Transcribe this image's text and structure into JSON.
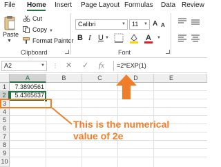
{
  "menu": {
    "tabs": [
      {
        "label": "File"
      },
      {
        "label": "Home"
      },
      {
        "label": "Insert"
      },
      {
        "label": "Page Layout"
      },
      {
        "label": "Formulas"
      },
      {
        "label": "Data"
      },
      {
        "label": "Review"
      }
    ],
    "active_tab": "Home"
  },
  "ribbon": {
    "clipboard": {
      "paste_label": "Paste",
      "cut_label": "Cut",
      "copy_label": "Copy",
      "format_painter_label": "Format Painter",
      "group_label": "Clipboard"
    },
    "font": {
      "font_name": "Calibri",
      "font_size": "11",
      "group_label": "Font",
      "bold_glyph": "B",
      "italic_glyph": "I",
      "underline_glyph": "U",
      "grow_glyph": "A",
      "shrink_glyph": "A"
    }
  },
  "formula_bar": {
    "name_box": "A2",
    "cancel_glyph": "✕",
    "enter_glyph": "✓",
    "fx_glyph": "fx",
    "formula": "=2*EXP(1)"
  },
  "grid": {
    "columns": [
      "A",
      "B",
      "C",
      "D",
      "E"
    ],
    "rows": [
      "1",
      "2",
      "3",
      "4",
      "5",
      "6",
      "7",
      "8",
      "9",
      "10"
    ],
    "selected_cell": "A2",
    "cells": {
      "A1": "7.3890561",
      "A2": "5.4365637"
    }
  },
  "annotation": {
    "text": "This is the numerical value of 2e",
    "color": "#f07d28"
  },
  "colors": {
    "excel_green": "#217346",
    "annotation_orange": "#f07d28",
    "font_color_red": "#e02020",
    "highlight_yellow": "#ffd400"
  }
}
